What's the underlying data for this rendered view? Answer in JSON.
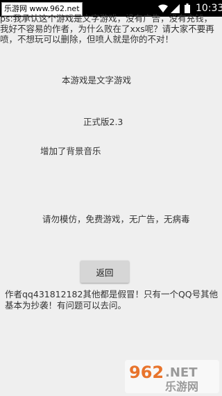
{
  "status_bar": {
    "watermark_site": "乐游网 www.962.net",
    "time": "10:33",
    "icons": [
      "wifi-icon",
      "signal-icon",
      "battery-icon"
    ]
  },
  "content": {
    "notice": "ps:我承认这个游戏是文字游戏，没有广告，没有充钱，我好不容易的作者，为什么败在了xxs呢？请大家不要再喷，不想玩可以删除，但喷人就是你的不对！",
    "line1": "本游戏是文字游戏",
    "version": "正式版2.3",
    "line2": "增加了背景音乐",
    "line3": "请勿模仿，免费游戏，无广告，无病毒",
    "back_button_label": "返回",
    "author_note": "作者qq431812182其他都是假冒！只有一个QQ号其他基本为抄袭！有问题可以去问。"
  },
  "watermark_logo": {
    "number": "962",
    "suffix": ".NET",
    "name": "乐游网"
  }
}
